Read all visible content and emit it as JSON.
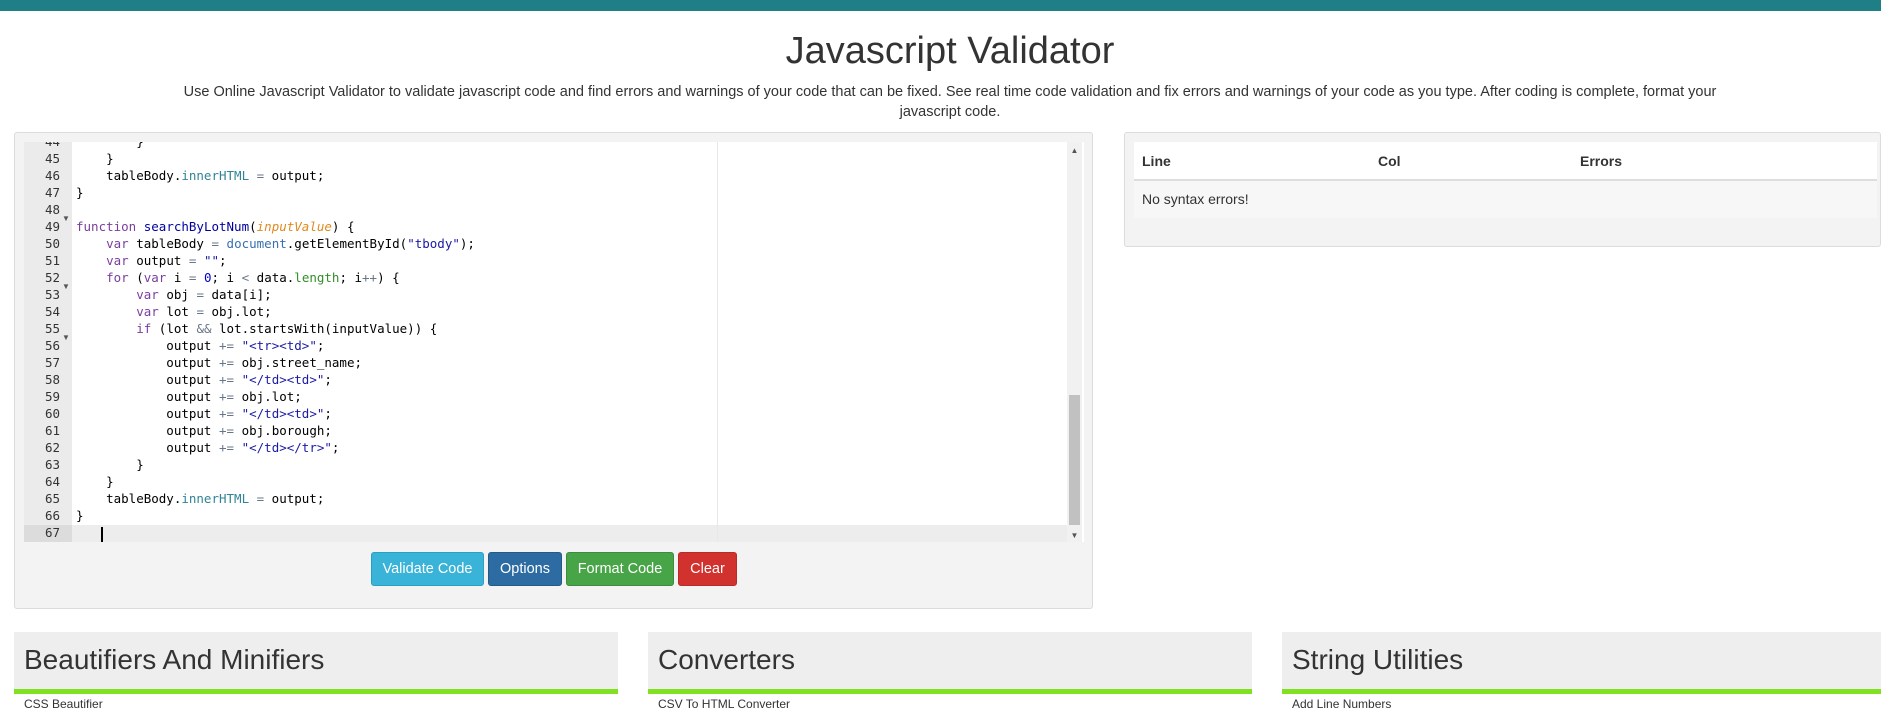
{
  "header": {
    "title": "Javascript Validator",
    "description": "Use Online Javascript Validator to validate javascript code and find errors and warnings of your code that can be fixed. See real time code validation and fix errors and warnings of your code as you type. After coding is complete, format your javascript code."
  },
  "editor": {
    "line_numbers": [
      "44",
      "45",
      "46",
      "47",
      "48",
      "49",
      "50",
      "51",
      "52",
      "53",
      "54",
      "55",
      "56",
      "57",
      "58",
      "59",
      "60",
      "61",
      "62",
      "63",
      "64",
      "65",
      "66",
      "67"
    ],
    "current_line": "67"
  },
  "buttons": {
    "validate": "Validate Code",
    "options": "Options",
    "format": "Format Code",
    "clear": "Clear"
  },
  "results": {
    "columns": [
      "Line",
      "Col",
      "Errors"
    ],
    "message": "No syntax errors!"
  },
  "cards": [
    {
      "title": "Beautifiers And Minifiers",
      "first_item": "CSS Beautifier"
    },
    {
      "title": "Converters",
      "first_item": "CSV To HTML Converter"
    },
    {
      "title": "String Utilities",
      "first_item": "Add Line Numbers"
    }
  ],
  "colors": {
    "topbar": "#1f7f86",
    "validate": "#39b3d7",
    "options": "#2d6ca2",
    "format": "#47a447",
    "clear": "#d2322d",
    "card_accent": "#7fe11f"
  }
}
